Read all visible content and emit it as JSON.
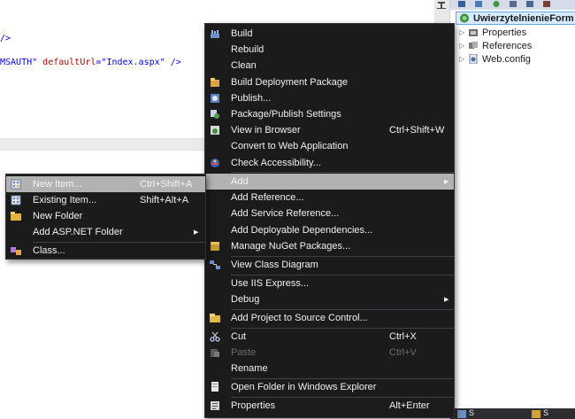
{
  "editor": {
    "lines": [
      {
        "parts": [
          {
            "text": "/>",
            "color": "blue"
          }
        ]
      },
      {
        "parts": [
          {
            "text": "MSAUTH\" ",
            "color": "blue"
          },
          {
            "text": "defaultUrl",
            "color": "red"
          },
          {
            "text": "=\"",
            "color": "blue"
          },
          {
            "text": "Index.aspx",
            "color": "blue"
          },
          {
            "text": "\" />",
            "color": "blue"
          }
        ]
      }
    ]
  },
  "solution_explorer": {
    "project": "UwierzytelnienieForm",
    "items": [
      {
        "label": "Properties",
        "icon": "wrench-icon"
      },
      {
        "label": "References",
        "icon": "references-icon"
      },
      {
        "label": "Web.config",
        "icon": "config-file-icon"
      }
    ],
    "bottom_tabs": [
      "S",
      "S"
    ]
  },
  "context_menu": {
    "items": [
      {
        "label": "Build",
        "shortcut": "",
        "icon": "build-icon"
      },
      {
        "label": "Rebuild",
        "shortcut": "",
        "icon": ""
      },
      {
        "label": "Clean",
        "shortcut": "",
        "icon": ""
      },
      {
        "label": "Build Deployment Package",
        "shortcut": "",
        "icon": "package-icon"
      },
      {
        "label": "Publish...",
        "shortcut": "",
        "icon": "publish-icon"
      },
      {
        "label": "Package/Publish Settings",
        "shortcut": "",
        "icon": "settings-icon"
      },
      {
        "label": "View in Browser",
        "shortcut": "Ctrl+Shift+W",
        "icon": "browser-icon"
      },
      {
        "label": "Convert to Web Application",
        "shortcut": "",
        "icon": ""
      },
      {
        "label": "Check Accessibility...",
        "shortcut": "",
        "icon": "accessibility-icon"
      },
      {
        "label": "Add",
        "shortcut": "",
        "icon": "",
        "submenu": true
      },
      {
        "label": "Add Reference...",
        "shortcut": "",
        "icon": ""
      },
      {
        "label": "Add Service Reference...",
        "shortcut": "",
        "icon": ""
      },
      {
        "label": "Add Deployable Dependencies...",
        "shortcut": "",
        "icon": ""
      },
      {
        "label": "Manage NuGet Packages...",
        "shortcut": "",
        "icon": "nuget-icon"
      },
      {
        "label": "View Class Diagram",
        "shortcut": "",
        "icon": "class-diagram-icon"
      },
      {
        "label": "Use IIS Express...",
        "shortcut": "",
        "icon": ""
      },
      {
        "label": "Debug",
        "shortcut": "",
        "icon": "",
        "submenu": true
      },
      {
        "label": "Add Project to Source Control...",
        "shortcut": "",
        "icon": "source-control-icon"
      },
      {
        "label": "Cut",
        "shortcut": "Ctrl+X",
        "icon": "scissors-icon"
      },
      {
        "label": "Paste",
        "shortcut": "Ctrl+V",
        "icon": "paste-icon",
        "disabled": true
      },
      {
        "label": "Rename",
        "shortcut": "",
        "icon": ""
      },
      {
        "label": "Open Folder in Windows Explorer",
        "shortcut": "",
        "icon": "folder-open-icon"
      },
      {
        "label": "Properties",
        "shortcut": "Alt+Enter",
        "icon": "properties-icon"
      }
    ]
  },
  "add_submenu": {
    "items": [
      {
        "label": "New Item...",
        "shortcut": "Ctrl+Shift+A",
        "icon": "new-item-icon"
      },
      {
        "label": "Existing Item...",
        "shortcut": "Shift+Alt+A",
        "icon": "existing-item-icon"
      },
      {
        "label": "New Folder",
        "shortcut": "",
        "icon": "folder-icon"
      },
      {
        "label": "Add ASP.NET Folder",
        "shortcut": "",
        "icon": "",
        "submenu": true
      },
      {
        "label": "Class...",
        "shortcut": "",
        "icon": "class-icon"
      }
    ]
  },
  "colors": {
    "menu_bg": "#1b1b1c",
    "menu_text": "#f1f1f1",
    "highlight": "#b2b2b2",
    "disabled": "#6d6d6d"
  }
}
